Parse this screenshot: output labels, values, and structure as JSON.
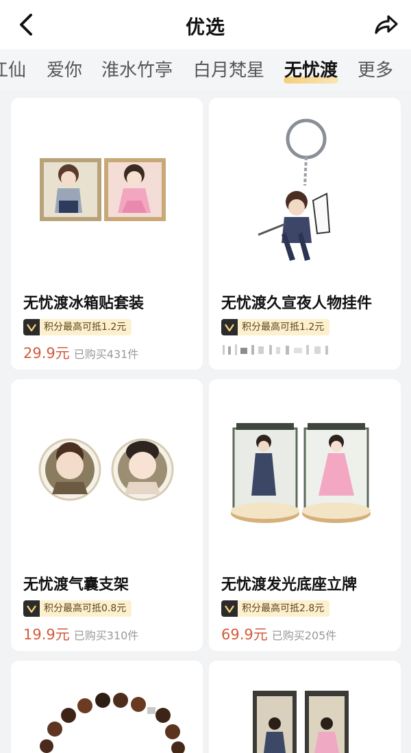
{
  "header": {
    "title": "优选",
    "back_icon": "chevron-left-icon",
    "share_icon": "share-arrow-icon"
  },
  "tabs": [
    {
      "label": "江仙"
    },
    {
      "label": "爱你"
    },
    {
      "label": "淮水竹亭"
    },
    {
      "label": "白月梵星"
    },
    {
      "label": "无忧渡",
      "active": true
    },
    {
      "label": "更多"
    }
  ],
  "colors": {
    "accent_price": "#d15a3b",
    "badge_bg": "#fdf0cf",
    "tab_underline": "#f7c96c"
  },
  "products": [
    {
      "title": "无忧渡冰箱贴套装",
      "points": "积分最高可抵1.2元",
      "price": "29.9元",
      "sold": "已购买431件"
    },
    {
      "title": "无忧渡久宣夜人物挂件",
      "points": "积分最高可抵1.2元",
      "price": "",
      "sold": ""
    },
    {
      "title": "无忧渡气囊支架",
      "points": "积分最高可抵0.8元",
      "price": "19.9元",
      "sold": "已购买310件"
    },
    {
      "title": "无忧渡发光底座立牌",
      "points": "积分最高可抵2.8元",
      "price": "69.9元",
      "sold": "已购买205件"
    },
    {
      "title": "",
      "points": "",
      "price": "",
      "sold": ""
    },
    {
      "title": "",
      "points": "",
      "price": "",
      "sold": ""
    }
  ]
}
